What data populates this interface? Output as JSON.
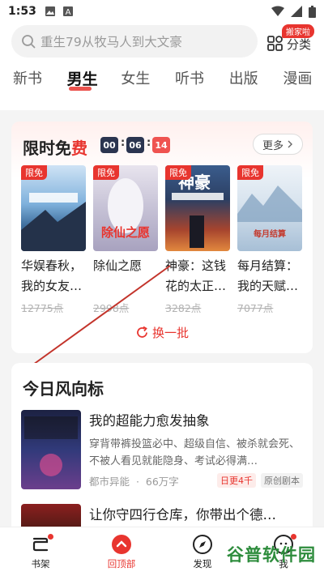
{
  "status_bar": {
    "time": "1:53"
  },
  "search": {
    "placeholder": "重生79从牧马人到大文豪"
  },
  "category": {
    "badge": "搬家啦",
    "label": "分类"
  },
  "tabs": [
    {
      "label": "新书"
    },
    {
      "label": "男生"
    },
    {
      "label": "女生"
    },
    {
      "label": "听书"
    },
    {
      "label": "出版"
    },
    {
      "label": "漫画"
    }
  ],
  "free_section": {
    "title_black": "限时免",
    "title_red": "费",
    "countdown": [
      "00",
      "06",
      "14"
    ],
    "more_label": "更多",
    "books": [
      {
        "tag": "限免",
        "title_line1": "华娱春秋，",
        "title_line2": "我的女友…",
        "points": "12775点",
        "cover_text": "从明星入仙"
      },
      {
        "tag": "限免",
        "title_line1": "除仙之愿",
        "title_line2": "",
        "points": "2998点",
        "cover_text": "除仙之愿"
      },
      {
        "tag": "限免",
        "title_line1": "神豪：这钱",
        "title_line2": "花的太正…",
        "points": "3282点",
        "cover_text": "神豪"
      },
      {
        "tag": "限免",
        "title_line1": "每月结算：",
        "title_line2": "我的天赋…",
        "points": "7077点",
        "cover_text": "每月结算"
      }
    ],
    "refresh_label": "换一批"
  },
  "wind_section": {
    "title": "今日风向标",
    "book1": {
      "title": "我的超能力愈发抽象",
      "desc": "穿背带裤投篮必中、超级自信、被杀就会死、不被人看见就能隐身、考试必得满…",
      "category": "都市异能",
      "words": "66万字",
      "badge_hot": "日更4千",
      "badge_orig": "原创剧本",
      "cover_text": "我的超能力愈发抽象"
    },
    "book2": {
      "title": "让你守四行仓库，你带出个德…"
    }
  },
  "bottom_nav": [
    {
      "label": "书架",
      "icon": "bookshelf-icon"
    },
    {
      "label": "回顶部",
      "icon": "back-to-top-icon"
    },
    {
      "label": "发现",
      "icon": "compass-icon"
    },
    {
      "label": "我",
      "icon": "profile-icon"
    }
  ],
  "watermark": {
    "text": "谷普软件园"
  },
  "colors": {
    "accent": "#e8352f",
    "countdown_dark": "#2b3550",
    "countdown_red": "#ef5350"
  }
}
